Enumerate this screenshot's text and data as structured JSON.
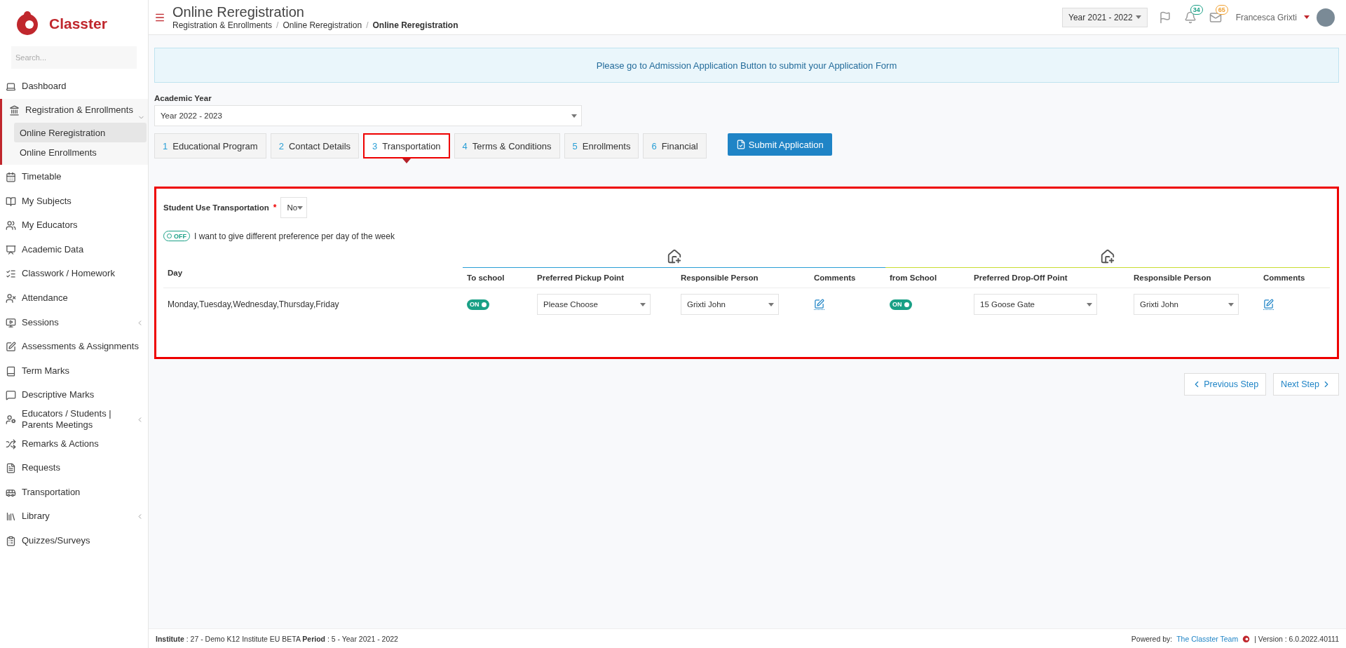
{
  "sidebar": {
    "brand": "Classter",
    "search": {
      "placeholder": "Search..."
    },
    "items": [
      {
        "label": "Dashboard",
        "expanded": false,
        "has_submenu": false
      },
      {
        "label": "Registration & Enrollments",
        "expanded": true,
        "has_submenu": true,
        "children": [
          {
            "label": "Online Reregistration",
            "selected": true
          },
          {
            "label": "Online Enrollments",
            "selected": false
          }
        ]
      },
      {
        "label": "Timetable",
        "expanded": false,
        "has_submenu": false
      },
      {
        "label": "My Subjects",
        "expanded": false,
        "has_submenu": false
      },
      {
        "label": "My Educators",
        "expanded": false,
        "has_submenu": false
      },
      {
        "label": "Academic Data",
        "expanded": false,
        "has_submenu": false
      },
      {
        "label": "Classwork / Homework",
        "expanded": false,
        "has_submenu": false
      },
      {
        "label": "Attendance",
        "expanded": false,
        "has_submenu": false
      },
      {
        "label": "Sessions",
        "expanded": false,
        "has_submenu": true
      },
      {
        "label": "Assessments & Assignments",
        "expanded": false,
        "has_submenu": false
      },
      {
        "label": "Term Marks",
        "expanded": false,
        "has_submenu": false
      },
      {
        "label": "Descriptive Marks",
        "expanded": false,
        "has_submenu": false
      },
      {
        "label": "Educators / Students | Parents Meetings",
        "expanded": false,
        "has_submenu": true
      },
      {
        "label": "Remarks & Actions",
        "expanded": false,
        "has_submenu": false
      },
      {
        "label": "Requests",
        "expanded": false,
        "has_submenu": false
      },
      {
        "label": "Transportation",
        "expanded": false,
        "has_submenu": false
      },
      {
        "label": "Library",
        "expanded": false,
        "has_submenu": true
      },
      {
        "label": "Quizzes/Surveys",
        "expanded": false,
        "has_submenu": false
      }
    ]
  },
  "header": {
    "title": "Online Reregistration",
    "separator": "/",
    "breadcrumbs": [
      "Registration & Enrollments",
      "Online Reregistration",
      "Online Reregistration"
    ],
    "year": "Year 2021 - 2022",
    "notifications": "34",
    "messages": "65",
    "user": "Francesca Grixti"
  },
  "alert": "Please go to Admission Application Button to submit your Application Form",
  "academic_year": {
    "label": "Academic Year",
    "value": "Year 2022 - 2023"
  },
  "tabs": [
    {
      "number": "1",
      "label": "Educational Program",
      "selected": false
    },
    {
      "number": "2",
      "label": "Contact Details",
      "selected": false
    },
    {
      "number": "3",
      "label": "Transportation",
      "selected": true
    },
    {
      "number": "4",
      "label": "Terms & Conditions",
      "selected": false
    },
    {
      "number": "5",
      "label": "Enrollments",
      "selected": false
    },
    {
      "number": "6",
      "label": "Financial",
      "selected": false
    }
  ],
  "submit_button": "Submit Application",
  "transport": {
    "label": "Student Use Transportation",
    "required": "*",
    "value": "No",
    "different_preference": {
      "on": false,
      "state_label": "OFF",
      "label": "I want to give different preference per day of the week"
    },
    "columns": [
      "Day",
      "To school",
      "Preferred Pickup Point",
      "Responsible Person",
      "Comments",
      "from School",
      "Preferred Drop-Off Point",
      "Responsible Person",
      "Comments"
    ],
    "rows": [
      {
        "day": "Monday,Tuesday,Wednesday,Thursday,Friday",
        "to_school": {
          "on": true,
          "label": "ON"
        },
        "pickup": "Please Choose",
        "pickup_person": "Grixti John",
        "from_school": {
          "on": true,
          "label": "ON"
        },
        "dropoff": "15 Goose Gate",
        "dropoff_person": "Grixti John"
      }
    ]
  },
  "nav": {
    "previous": "Previous Step",
    "next": "Next Step"
  },
  "footer": {
    "institute": "**Institute** : 27 - Demo K12 Institute EU BETA **Period** : 5 - Year 2021 - 2022",
    "powered": "Powered by:",
    "team": "The Classter Team",
    "version": "| Version : 6.0.2022.40111"
  }
}
